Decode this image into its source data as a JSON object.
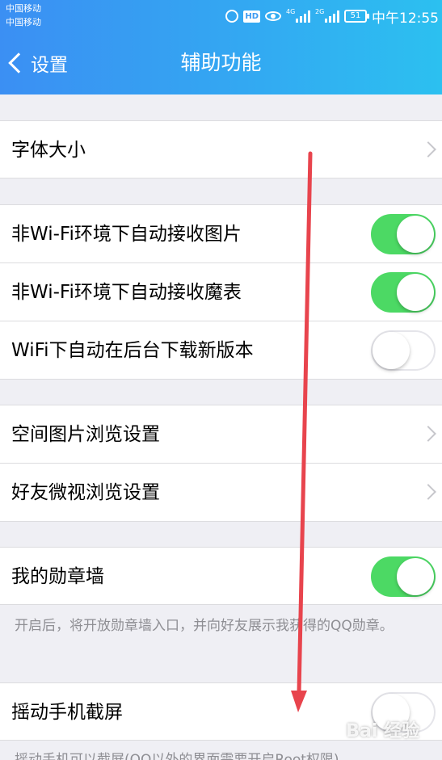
{
  "status_bar": {
    "carrier_1": "中国移动",
    "carrier_2": "中国移动",
    "hd": "HD",
    "net_1": "4G",
    "net_2": "2G",
    "battery": "51",
    "time": "中午12:55"
  },
  "nav": {
    "back_label": "设置",
    "title": "辅助功能"
  },
  "settings": {
    "font_size": "字体大小",
    "auto_recv_pics": "非Wi-Fi环境下自动接收图片",
    "auto_recv_emoticons": "非Wi-Fi环境下自动接收魔表",
    "wifi_bg_download": "WiFi下自动在后台下载新版本",
    "qzone_pic_browse": "空间图片浏览设置",
    "friend_video_browse": "好友微视浏览设置",
    "medal_wall": "我的勋章墙",
    "medal_wall_note": "开启后，将开放勋章墙入口，并向好友展示我获得的QQ勋章。",
    "shake_screenshot": "摇动手机截屏",
    "shake_note_partial": "摇动手机可以截屏(QQ以外的界面需要开启Root权限)"
  },
  "toggles": {
    "auto_recv_pics": true,
    "auto_recv_emoticons": true,
    "wifi_bg_download": false,
    "medal_wall": true,
    "shake_screenshot": false
  },
  "colors": {
    "header_gradient_start": "#3b8ff3",
    "header_gradient_end": "#2cc0f0",
    "toggle_on": "#4cd964",
    "annotation_arrow": "#e8444d"
  },
  "watermark": "Bai 经验"
}
